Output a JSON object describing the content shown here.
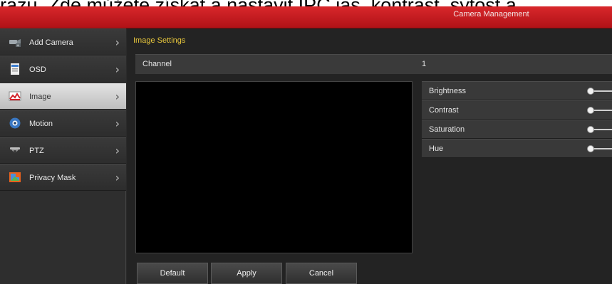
{
  "caption": "razu. Zde můžete získat a nastavit IPC jas, kontrast, sytost a",
  "window": {
    "title": "Camera Management"
  },
  "sidebar": {
    "items": [
      {
        "label": "Add Camera",
        "icon": "camera-plus-icon",
        "active": false
      },
      {
        "label": "OSD",
        "icon": "osd-icon",
        "active": false
      },
      {
        "label": "Image",
        "icon": "image-chart-icon",
        "active": true
      },
      {
        "label": "Motion",
        "icon": "motion-icon",
        "active": false
      },
      {
        "label": "PTZ",
        "icon": "ptz-camera-icon",
        "active": false
      },
      {
        "label": "Privacy Mask",
        "icon": "privacy-mask-icon",
        "active": false
      }
    ]
  },
  "main": {
    "section_title": "Image Settings",
    "channel": {
      "label": "Channel",
      "value": "1"
    },
    "adjustments": [
      {
        "label": "Brightness"
      },
      {
        "label": "Contrast"
      },
      {
        "label": "Saturation"
      },
      {
        "label": "Hue"
      }
    ],
    "buttons": {
      "default": "Default",
      "apply": "Apply",
      "cancel": "Cancel"
    }
  },
  "colors": {
    "title_bar": "#c4181d",
    "section_title": "#e7c63c",
    "panel": "#2a2a2a"
  }
}
